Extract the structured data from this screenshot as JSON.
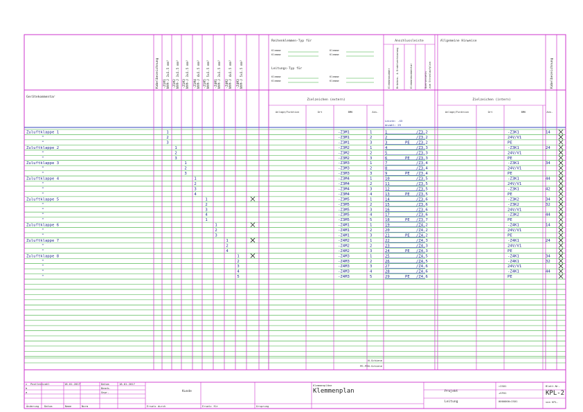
{
  "header": {
    "kabelbezeichnung": "Kabelbezeichnung",
    "wire_columns": [
      [
        "-Z1M1",
        "NYM-J 3x1.5 mm²"
      ],
      [
        "-Z1M2",
        "NYM-J 3x1.5 mm²"
      ],
      [
        "-Z1M3",
        "NYM-J 3x1.5 mm²"
      ],
      [
        "-Z1M4",
        "NYM-J 4x1.5 mm²"
      ],
      [
        "-Z1M5",
        "NYM-J 5x1.5 mm²"
      ],
      [
        "-Z4M1",
        "NYM-J 3x1.5 mm²"
      ],
      [
        "-Z4M2",
        "NYM-J 4x1.5 mm²"
      ],
      [
        "-Z4M3",
        "NYM-J 5x1.5 mm²"
      ]
    ],
    "reihenklemmen": {
      "title": "Reihenklemmen-Typ für",
      "rows": [
        [
          "Klemme",
          "Klemme"
        ],
        [
          "Klemme",
          "Klemme"
        ]
      ]
    },
    "leitungs": {
      "title": "Leitungs-Typ für",
      "rows": [
        [
          "Klemme",
          "Klemme"
        ],
        [
          "Klemme",
          "Klemme"
        ]
      ]
    },
    "anschluss": {
      "title": "Anschlussleiste",
      "vertical": [
        "Klemmennummer",
        "Brücken- & Drahtverbindung",
        "Klemmenkommentar",
        "Querverweis zum Stromlaufplan"
      ]
    },
    "hinweise": "Allgemeine Hinweise",
    "geraetekommentar": "Gerätekommentar",
    "ziel_extern": "Zielzeichen (extern)",
    "ziel_intern": "Zielzeichen (intern)",
    "sub_cols": [
      "Anlage/Funktion",
      "Ort",
      "BMK",
      "Ans."
    ],
    "leiste": "Leiste: -X3",
    "anzahl": "Anzahl: 29"
  },
  "rows": [
    {
      "k": "Zuluftklappe 1",
      "c": 0,
      "n": "1",
      "ext": "-Z3M1",
      "a": "1",
      "kl": "1",
      "pe": "",
      "ref": "/Z3.2",
      "int": "-Z3K1",
      "ia": "14",
      "x": true
    },
    {
      "k": "\"",
      "c": 0,
      "n": "2",
      "ext": "-Z3M1",
      "a": "2",
      "kl": "2",
      "pe": "",
      "ref": "/Z3.2",
      "int": "24V/V1",
      "ia": "",
      "x": true
    },
    {
      "k": "\"",
      "c": 0,
      "n": "3",
      "ext": "-Z3M1",
      "a": "3",
      "kl": "3",
      "pe": "PE",
      "ref": "/Z3.2",
      "int": "PE",
      "ia": "",
      "x": true
    },
    {
      "k": "Zuluftklappe 2",
      "c": 1,
      "n": "1",
      "ext": "-Z3M2",
      "a": "1",
      "kl": "4",
      "pe": "",
      "ref": "/Z3.3",
      "int": "-Z3K1",
      "ia": "24",
      "x": true
    },
    {
      "k": "\"",
      "c": 1,
      "n": "2",
      "ext": "-Z3M2",
      "a": "2",
      "kl": "5",
      "pe": "",
      "ref": "/Z3.3",
      "int": "24V/V1",
      "ia": "",
      "x": true
    },
    {
      "k": "\"",
      "c": 1,
      "n": "3",
      "ext": "-Z3M2",
      "a": "3",
      "kl": "6",
      "pe": "PE",
      "ref": "/Z3.3",
      "int": "PE",
      "ia": "",
      "x": true
    },
    {
      "k": "Zuluftklappe 3",
      "c": 2,
      "n": "1",
      "ext": "-Z3M3",
      "a": "1",
      "kl": "7",
      "pe": "",
      "ref": "/Z3.4",
      "int": "-Z3K1",
      "ia": "34",
      "x": true
    },
    {
      "k": "\"",
      "c": 2,
      "n": "2",
      "ext": "-Z3M3",
      "a": "2",
      "kl": "8",
      "pe": "",
      "ref": "/Z3.4",
      "int": "24V/V1",
      "ia": "",
      "x": true
    },
    {
      "k": "\"",
      "c": 2,
      "n": "3",
      "ext": "-Z3M3",
      "a": "3",
      "kl": "9",
      "pe": "PE",
      "ref": "/Z3.4",
      "int": "PE",
      "ia": "",
      "x": true
    },
    {
      "k": "Zuluftklappe 4",
      "c": 3,
      "n": "1",
      "ext": "-Z3M4",
      "a": "1",
      "kl": "10",
      "pe": "",
      "ref": "/Z3.5",
      "int": "-Z3K1",
      "ia": "44",
      "x": true
    },
    {
      "k": "\"",
      "c": 3,
      "n": "2",
      "ext": "-Z3M4",
      "a": "2",
      "kl": "11",
      "pe": "",
      "ref": "/Z3.5",
      "int": "24V/V1",
      "ia": "",
      "x": true
    },
    {
      "k": "\"",
      "c": 3,
      "n": "3",
      "ext": "-Z3M4",
      "a": "3",
      "kl": "12",
      "pe": "",
      "ref": "/Z3.5",
      "int": "-Z3K1",
      "ia": "42",
      "x": true
    },
    {
      "k": "\"",
      "c": 3,
      "n": "4",
      "ext": "-Z3M4",
      "a": "4",
      "kl": "13",
      "pe": "PE",
      "ref": "/Z3.5",
      "int": "PE",
      "ia": "",
      "x": true
    },
    {
      "k": "Zuluftklappe 5",
      "c": 4,
      "n": "1",
      "ext": "-Z3M5",
      "a": "1",
      "kl": "14",
      "pe": "",
      "ref": "/Z3.6",
      "int": "-Z3K2",
      "ia": "34",
      "x": true,
      "gx": true
    },
    {
      "k": "\"",
      "c": 4,
      "n": "2",
      "ext": "-Z3M5",
      "a": "2",
      "kl": "15",
      "pe": "",
      "ref": "/Z3.6",
      "int": "-Z3K2",
      "ia": "32",
      "x": true
    },
    {
      "k": "\"",
      "c": 4,
      "n": "3",
      "ext": "-Z3M5",
      "a": "3",
      "kl": "16",
      "pe": "",
      "ref": "/Z3.6",
      "int": "24V/V1",
      "ia": "",
      "x": true
    },
    {
      "k": "\"",
      "c": 4,
      "n": "4",
      "ext": "-Z3M5",
      "a": "4",
      "kl": "17",
      "pe": "",
      "ref": "/Z3.6",
      "int": "-Z3K2",
      "ia": "44",
      "x": true
    },
    {
      "k": "\"",
      "c": 4,
      "n": "1",
      "ext": "-Z3M5",
      "a": "5",
      "kl": "18",
      "pe": "PE",
      "ref": "/Z3.7",
      "int": "PE",
      "ia": "",
      "x": true
    },
    {
      "k": "Zuluftklappe 6",
      "c": 5,
      "n": "1",
      "ext": "-Z4M1",
      "a": "1",
      "kl": "19",
      "pe": "",
      "ref": "/Z4.2",
      "int": "-Z4K1",
      "ia": "14",
      "x": true,
      "gx": true
    },
    {
      "k": "\"",
      "c": 5,
      "n": "2",
      "ext": "-Z4M1",
      "a": "2",
      "kl": "20",
      "pe": "",
      "ref": "/Z4.2",
      "int": "24V/V1",
      "ia": "",
      "x": true
    },
    {
      "k": "\"",
      "c": 5,
      "n": "3",
      "ext": "-Z4M1",
      "a": "3",
      "kl": "21",
      "pe": "PE",
      "ref": "/Z4.2",
      "int": "PE",
      "ia": "",
      "x": true
    },
    {
      "k": "Zuluftklappe 7",
      "c": 6,
      "n": "1",
      "ext": "-Z4M2",
      "a": "1",
      "kl": "22",
      "pe": "",
      "ref": "/Z4.3",
      "int": "-Z4K1",
      "ia": "24",
      "x": true,
      "gx": true
    },
    {
      "k": "\"",
      "c": 6,
      "n": "2",
      "ext": "-Z4M2",
      "a": "2",
      "kl": "23",
      "pe": "",
      "ref": "/Z4.3",
      "int": "24V/V1",
      "ia": "",
      "x": true
    },
    {
      "k": "\"",
      "c": 6,
      "n": "4",
      "ext": "-Z4M2",
      "a": "3",
      "kl": "24",
      "pe": "PE",
      "ref": "/Z4.3",
      "int": "PE",
      "ia": "",
      "x": true
    },
    {
      "k": "Zuluftklappe 8",
      "c": 7,
      "n": "1",
      "ext": "-Z4M3",
      "a": "1",
      "kl": "25",
      "pe": "",
      "ref": "/Z4.5",
      "int": "-Z4K1",
      "ia": "34",
      "x": true,
      "gx": true
    },
    {
      "k": "\"",
      "c": 7,
      "n": "2",
      "ext": "-Z4M3",
      "a": "2",
      "kl": "26",
      "pe": "",
      "ref": "/Z4.5",
      "int": "-Z4K1",
      "ia": "32",
      "x": true
    },
    {
      "k": "\"",
      "c": 7,
      "n": "3",
      "ext": "-Z4M3",
      "a": "3",
      "kl": "27",
      "pe": "",
      "ref": "/Z4.6",
      "int": "24V/V1",
      "ia": "",
      "x": true
    },
    {
      "k": "\"",
      "c": 7,
      "n": "4",
      "ext": "-Z4M3",
      "a": "4",
      "kl": "28",
      "pe": "",
      "ref": "/Z4.6",
      "int": "-Z4K1",
      "ia": "44",
      "x": true
    },
    {
      "k": "\"",
      "c": 7,
      "n": "5",
      "ext": "-Z4M3",
      "a": "5",
      "kl": "29",
      "pe": "PE",
      "ref": "/Z4.6",
      "int": "PE",
      "ia": "",
      "x": true
    }
  ],
  "bottom": {
    "n_schiene": "N-Schiene",
    "pe_schiene": "PE-PEN-Schiene"
  },
  "title_block": {
    "left_rows": [
      [
        "c",
        "Postleitzahl",
        "18.01.2017",
        "Datum",
        "18.01.2017"
      ],
      [
        "b",
        "",
        "",
        "Bearb.",
        ""
      ],
      [
        "a",
        "",
        "",
        "Gepr.",
        ""
      ]
    ],
    "bottom_labels": [
      "Änderung",
      "Datum",
      "Name",
      "Norm",
      "Ersatz durch",
      "Ersatz für",
      "Ursprung"
    ],
    "kunde": "Kunde",
    "doc_small": "Klemmenpläne",
    "doc_big": "Klemmenplan",
    "projekt": "Projekt",
    "leitung": "Leitung",
    "code1": "=IS01",
    "code2": "+SF01",
    "code3": "0000000=IS01",
    "blatt_label": "Blatt-Nr.",
    "blatt": "KPL-2",
    "von": "von KPL-"
  },
  "colors": {
    "grid": "#cc33cc",
    "rows": "#33aa33",
    "text": "#1e2a8c",
    "blue": "#3344bb"
  }
}
